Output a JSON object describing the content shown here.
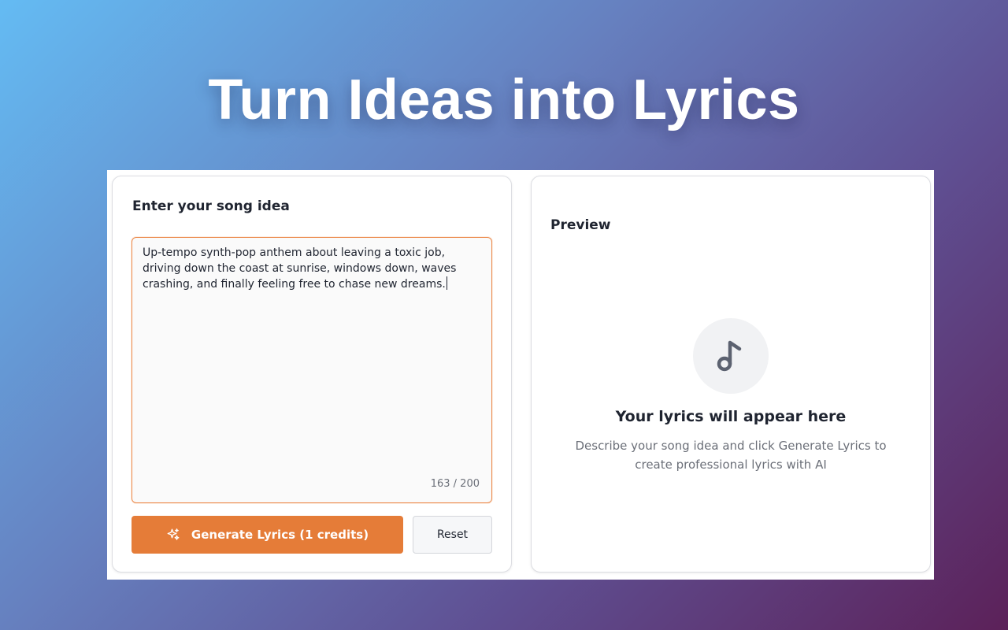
{
  "hero": {
    "title": "Turn Ideas into Lyrics"
  },
  "input_card": {
    "heading": "Enter your song idea",
    "idea_text": "Up-tempo synth-pop anthem about leaving a toxic job, driving down the coast at sunrise, windows down, waves crashing, and finally feeling free to chase new dreams.",
    "char_counter": "163 / 200",
    "generate_label": "Generate Lyrics (1 credits)",
    "generate_icon": "sparkles-icon",
    "reset_label": "Reset"
  },
  "preview_card": {
    "heading": "Preview",
    "empty_icon": "music-note-icon",
    "empty_title": "Your lyrics will appear here",
    "empty_description": "Describe your song idea and click Generate Lyrics to create professional lyrics with AI"
  },
  "colors": {
    "accent": "#e57c38",
    "input_border": "#ec8a4c",
    "text_primary": "#1f2430",
    "text_muted": "#6b6f78"
  }
}
